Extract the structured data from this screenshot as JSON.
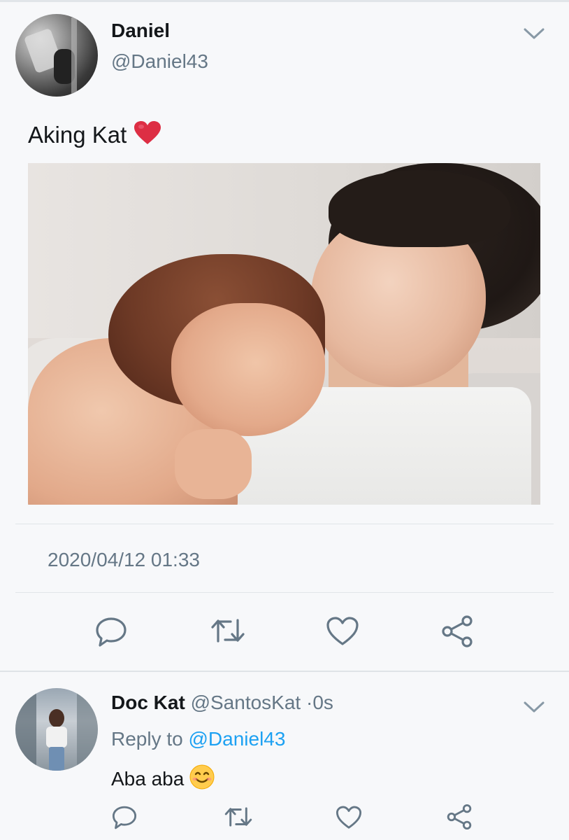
{
  "tweet": {
    "author_name": "Daniel",
    "author_handle": "@Daniel43",
    "text": "Aking Kat",
    "emoji": "red-heart",
    "timestamp": "2020/04/12 01:33",
    "actions": [
      "reply-icon",
      "retweet-icon",
      "like-icon",
      "share-icon"
    ]
  },
  "reply": {
    "author_name": "Doc Kat",
    "author_handle": "@SantosKat",
    "separator": "·",
    "age": "0s",
    "reply_to_label": "Reply to",
    "reply_to_mention": "@Daniel43",
    "text": "Aba aba",
    "emoji": "smiling-face",
    "actions": [
      "reply-icon",
      "retweet-icon",
      "like-icon",
      "share-icon"
    ]
  },
  "colors": {
    "background": "#f7f8fa",
    "primary_text": "#14171a",
    "secondary_text": "#657786",
    "link": "#1da1f2",
    "icon": "#657786",
    "divider": "#e1e5e9",
    "heart": "#e0245e"
  }
}
